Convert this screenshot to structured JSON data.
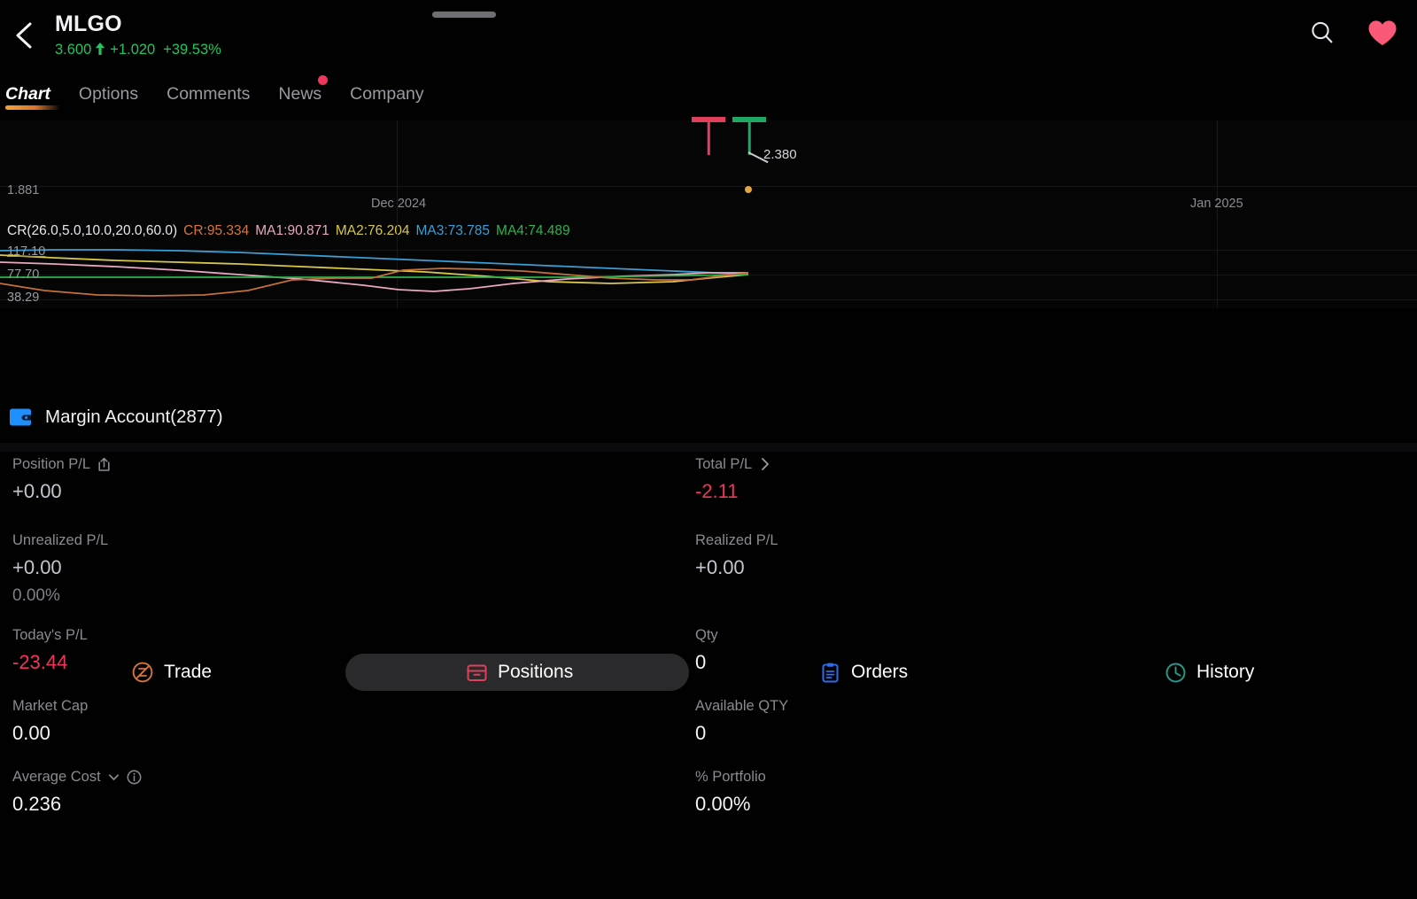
{
  "header": {
    "back_icon": "chevron-left-icon",
    "symbol": "MLGO",
    "price": "3.600",
    "arrow": "▲",
    "change": "+1.020",
    "change_pct": "+39.53%",
    "search_icon": "search-icon",
    "favorite_icon": "heart-icon",
    "accent_up": "#22c55e",
    "favorite_color": "#fa5a78"
  },
  "tabs": [
    {
      "label": "Chart",
      "active": true,
      "badge": false
    },
    {
      "label": "Options",
      "active": false,
      "badge": false
    },
    {
      "label": "Comments",
      "active": false,
      "badge": false
    },
    {
      "label": "News",
      "active": false,
      "badge": true
    },
    {
      "label": "Company",
      "active": false,
      "badge": false
    }
  ],
  "chart": {
    "price_axis_label": "1.881",
    "date_labels": [
      "Dec 2024",
      "Jan 2025"
    ],
    "last_price_annotation": "2.380",
    "fullscreen_icon": "fullscreen-icon",
    "candles": [
      {
        "type": "down",
        "color": "#e0405c",
        "open": 2.55,
        "close": 2.55,
        "high": 2.56,
        "low": 2.33
      },
      {
        "type": "up",
        "color": "#1fa864",
        "open": 2.56,
        "close": 2.56,
        "high": 2.57,
        "low": 2.38
      }
    ]
  },
  "indicator": {
    "title": "CR(26.0,5.0,10.0,20.0,60.0)",
    "series": [
      {
        "name": "CR",
        "label": "CR:95.334",
        "value": 95.334,
        "color": "#d4763c"
      },
      {
        "name": "MA1",
        "label": "MA1:90.871",
        "value": 90.871,
        "color": "#e8a8c0"
      },
      {
        "name": "MA2",
        "label": "MA2:76.204",
        "value": 76.204,
        "color": "#d8c84a"
      },
      {
        "name": "MA3",
        "label": "MA3:73.785",
        "value": 73.785,
        "color": "#3a9fd4"
      },
      {
        "name": "MA4",
        "label": "MA4:74.489",
        "value": 74.489,
        "color": "#2db34a"
      }
    ],
    "scale_labels": [
      "117.10",
      "77.70",
      "38.29"
    ]
  },
  "segments": [
    {
      "label": "Trade",
      "icon": "trade-icon",
      "color": "#d4763c",
      "selected": false
    },
    {
      "label": "Positions",
      "icon": "positions-icon",
      "color": "#e0405c",
      "selected": true
    },
    {
      "label": "Orders",
      "icon": "orders-icon",
      "color": "#2d6bf0",
      "selected": false
    },
    {
      "label": "History",
      "icon": "history-icon",
      "color": "#1f9e8c",
      "selected": false
    }
  ],
  "account": {
    "icon": "wallet-icon",
    "label": "Margin Account(2877)",
    "icon_color": "#1f8fff"
  },
  "stats": [
    {
      "left": {
        "label": "Position P/L",
        "icon": "share-icon",
        "value": "+0.00",
        "style": "muted"
      },
      "right": {
        "label": "Total P/L",
        "icon": "chevron-right-icon",
        "value": "-2.11",
        "style": "red"
      }
    },
    {
      "left": {
        "label": "Unrealized P/L",
        "icon": null,
        "value": "+0.00",
        "sub": "0.00%",
        "style": "muted"
      },
      "right": {
        "label": "Realized P/L",
        "icon": null,
        "value": "+0.00",
        "style": "muted"
      }
    },
    {
      "left": {
        "label": "Today's P/L",
        "icon": null,
        "value": "-23.44",
        "style": "red"
      },
      "right": {
        "label": "Qty",
        "icon": null,
        "value": "0",
        "style": "white"
      }
    },
    {
      "left": {
        "label": "Market Cap",
        "icon": null,
        "value": "0.00",
        "style": "white"
      },
      "right": {
        "label": "Available QTY",
        "icon": null,
        "value": "0",
        "style": "white"
      }
    },
    {
      "left": {
        "label": "Average Cost",
        "icon": "chevron-down-icon",
        "icon2": "info-icon",
        "value": "0.236",
        "style": "white"
      },
      "right": {
        "label": "% Portfolio",
        "icon": null,
        "value": "0.00%",
        "style": "white"
      }
    }
  ]
}
